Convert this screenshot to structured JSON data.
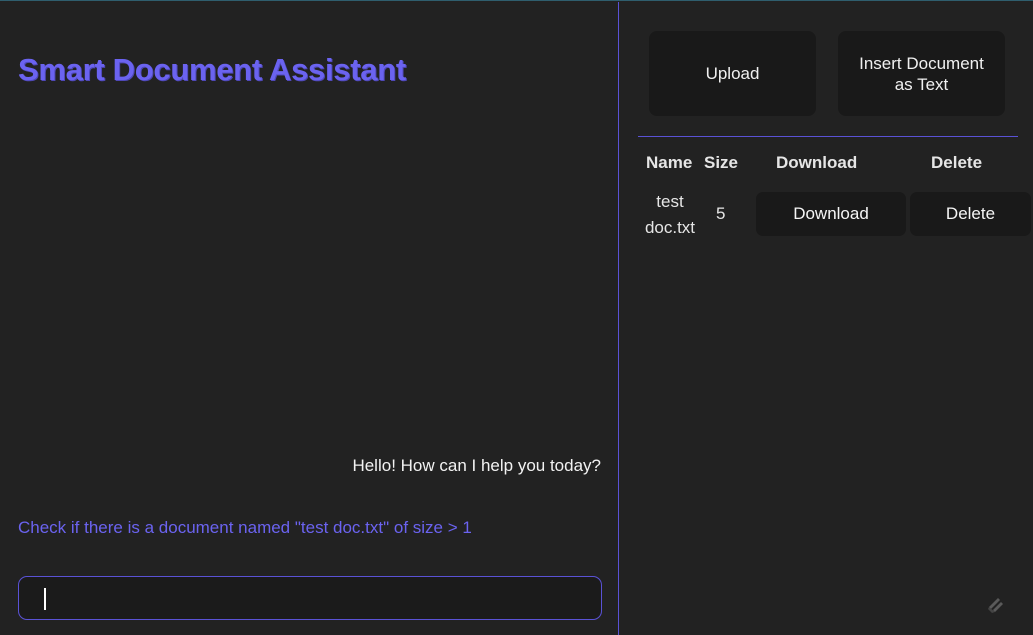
{
  "chat": {
    "title": "Smart Document Assistant",
    "messages": [
      {
        "role": "assistant",
        "text": "Hello! How can I help you today?"
      },
      {
        "role": "user",
        "text": "Check if there is a document named \"test doc.txt\" of size > 1"
      }
    ],
    "input": {
      "value": "",
      "placeholder": ""
    }
  },
  "documents": {
    "upload_label": "Upload",
    "insert_label": "Insert Document as Text",
    "columns": [
      "Name",
      "Size",
      "Download",
      "Delete"
    ],
    "rows": [
      {
        "name": "test doc.txt",
        "size": "5",
        "download_label": "Download",
        "delete_label": "Delete"
      }
    ]
  },
  "colors": {
    "accent": "#6b63f0",
    "border": "#5a52d6",
    "background": "#222222",
    "button": "#191919"
  },
  "icons": {
    "corner": "streamlit-logo-icon"
  }
}
